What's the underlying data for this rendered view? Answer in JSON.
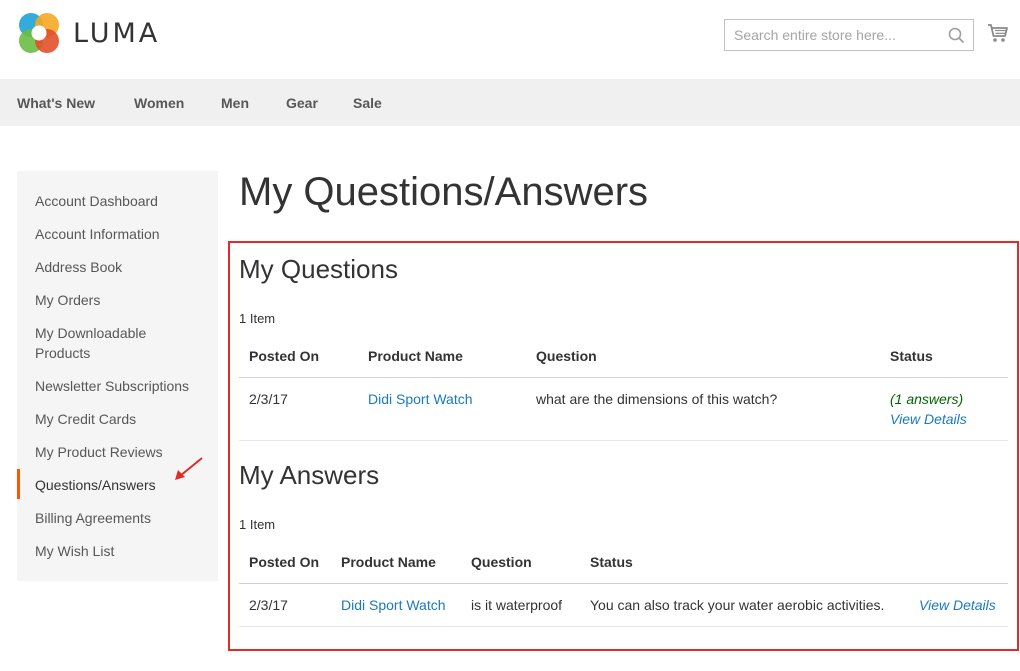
{
  "header": {
    "logo_text": "LUMA",
    "search_placeholder": "Search entire store here..."
  },
  "nav": {
    "items": [
      "What's New",
      "Women",
      "Men",
      "Gear",
      "Sale"
    ]
  },
  "sidebar": {
    "items": [
      "Account Dashboard",
      "Account Information",
      "Address Book",
      "My Orders",
      "My Downloadable Products",
      "Newsletter Subscriptions",
      "My Credit Cards",
      "My Product Reviews",
      "Questions/Answers",
      "Billing Agreements",
      "My Wish List"
    ],
    "active": "Questions/Answers"
  },
  "page": {
    "title": "My Questions/Answers"
  },
  "questions": {
    "title": "My Questions",
    "count": "1 Item",
    "headers": [
      "Posted On",
      "Product Name",
      "Question",
      "Status"
    ],
    "rows": [
      {
        "posted_on": "2/3/17",
        "product": "Didi Sport Watch",
        "question": "what are the dimensions of this watch?",
        "answers": "(1 answers)",
        "details": "View Details"
      }
    ]
  },
  "answers": {
    "title": "My Answers",
    "count": "1 Item",
    "headers": [
      "Posted On",
      "Product Name",
      "Question",
      "Status"
    ],
    "rows": [
      {
        "posted_on": "2/3/17",
        "product": "Didi Sport Watch",
        "question": "is it waterproof",
        "status": "You can also track your water aerobic activities.",
        "details": "View Details"
      }
    ]
  },
  "colors": {
    "accent": "#ff5501",
    "link": "#1979c3",
    "highlight": "#e02b27"
  }
}
